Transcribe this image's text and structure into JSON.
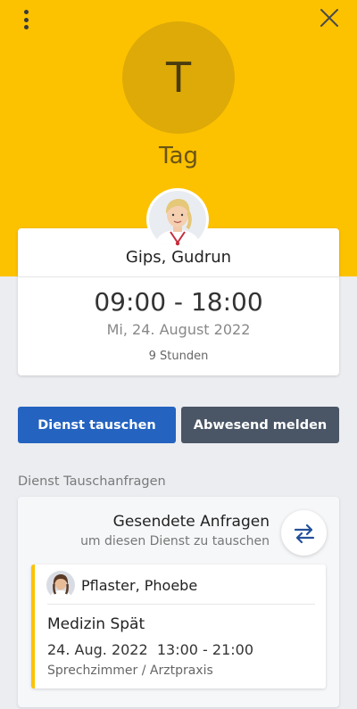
{
  "header": {
    "menu_icon": "more-vert-icon",
    "close_icon": "close-icon",
    "shift_letter": "T",
    "shift_name": "Tag",
    "accent_color": "#fcc200"
  },
  "employee": {
    "name": "Gips, Gudrun",
    "avatar": "doctor-photo"
  },
  "shift": {
    "time": "09:00 - 18:00",
    "date": "Mi, 24. August 2022",
    "duration": "9 Stunden"
  },
  "actions": {
    "swap_label": "Dienst tauschen",
    "absent_label": "Abwesend melden",
    "swap_color": "#2463c0",
    "absent_color": "#4a5666"
  },
  "swap_requests": {
    "section_label": "Dienst Tauschanfragen",
    "title": "Gesendete Anfragen",
    "subtitle": "um diesen Dienst zu tauschen",
    "icon": "swap-arrows-icon",
    "items": [
      {
        "name": "Pflaster, Phoebe",
        "shift_name": "Medizin Spät",
        "date_time": "24. Aug. 2022  13:00 - 21:00",
        "location": "Sprechzimmer / Arztpraxis"
      }
    ]
  }
}
